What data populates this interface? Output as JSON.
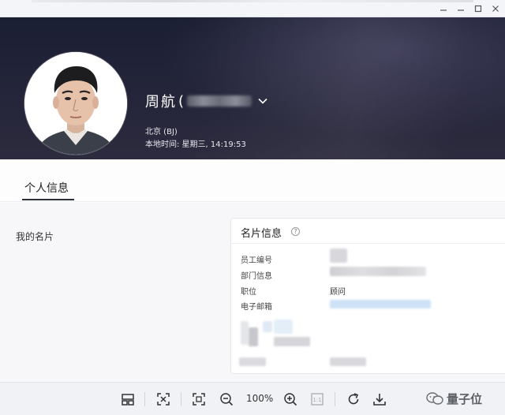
{
  "window": {
    "minimize_icon": "minimize-icon",
    "maximize_icon": "maximize-icon",
    "close_icon": "close-icon"
  },
  "profile": {
    "name": "周航",
    "paren": "(",
    "location": "北京 (BJ)",
    "local_time": "本地时间:  星期三,  14:19:53"
  },
  "tabs": [
    {
      "label": "个人信息",
      "active": true
    }
  ],
  "section": {
    "my_card_label": "我的名片"
  },
  "card": {
    "title": "名片信息",
    "help_glyph": "?",
    "fields": [
      {
        "label": "员工编号",
        "value": ""
      },
      {
        "label": "部门信息",
        "value": ""
      },
      {
        "label": "职位",
        "value": "顾问"
      },
      {
        "label": "电子邮箱",
        "value": ""
      }
    ]
  },
  "toolbar": {
    "zoom_level": "100%",
    "actual_size_label": "1:1",
    "buttons": [
      "thumbnails-icon",
      "fit-window-icon",
      "fullscreen-icon",
      "zoom-out-icon",
      "zoom-in-icon",
      "actual-size-icon",
      "rotate-icon",
      "download-icon"
    ]
  },
  "watermark": {
    "text": "量子位"
  },
  "colors": {
    "banner_dark": "#1b1f33",
    "email_link": "#cfe3f6",
    "toolbar_bg": "#f1f2f5"
  }
}
